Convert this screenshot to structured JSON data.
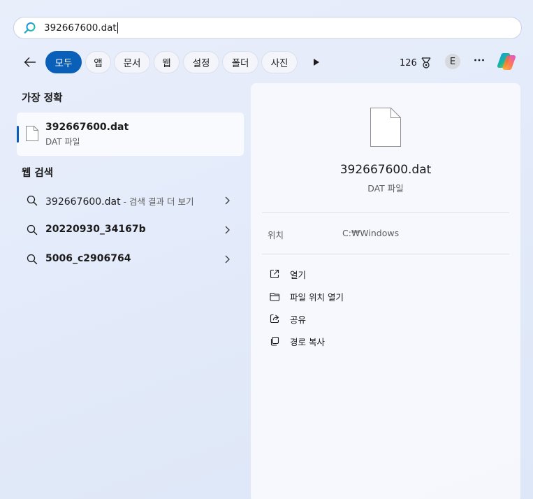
{
  "search": {
    "query": "392667600.dat"
  },
  "filters": {
    "back_icon": "back-arrow-icon",
    "chips": [
      "모두",
      "앱",
      "문서",
      "웹",
      "설정",
      "폴더",
      "사진"
    ],
    "active_index": 0
  },
  "toolbar": {
    "points": "126",
    "points_icon": "rewards-medal-icon",
    "avatar_letter": "E",
    "more_icon": "more-ellipsis-icon",
    "copilot_icon": "copilot-icon"
  },
  "best_match": {
    "section_title": "가장 정확",
    "name": "392667600.dat",
    "type": "DAT 파일"
  },
  "web_search": {
    "section_title": "웹 검색",
    "items": [
      {
        "label": "392667600.dat",
        "suffix": " - 검색 결과 더 보기"
      },
      {
        "label": "20220930_34167b",
        "suffix": ""
      },
      {
        "label": "5006_c2906764",
        "suffix": ""
      }
    ]
  },
  "detail": {
    "name": "392667600.dat",
    "type": "DAT 파일",
    "location_label": "위치",
    "location_value": "C:₩Windows",
    "actions": [
      {
        "label": "열기",
        "icon": "open-external-icon"
      },
      {
        "label": "파일 위치 열기",
        "icon": "folder-icon"
      },
      {
        "label": "공유",
        "icon": "share-icon"
      },
      {
        "label": "경로 복사",
        "icon": "copy-icon"
      }
    ]
  },
  "colors": {
    "accent": "#0a5fb8",
    "background": "#e6ecfa"
  }
}
